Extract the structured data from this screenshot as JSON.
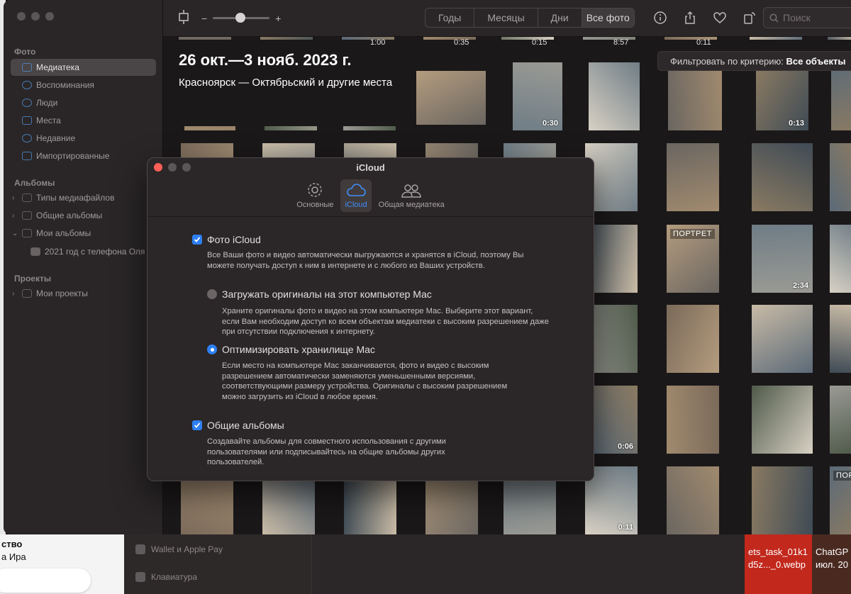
{
  "sidebar": {
    "sections": [
      {
        "header": "Фото",
        "items": [
          {
            "label": "Медиатека",
            "icon": "library-icon",
            "active": true
          },
          {
            "label": "Воспоминания",
            "icon": "memories-icon"
          },
          {
            "label": "Люди",
            "icon": "people-icon"
          },
          {
            "label": "Места",
            "icon": "places-icon"
          },
          {
            "label": "Недавние",
            "icon": "recent-icon"
          },
          {
            "label": "Импортированные",
            "icon": "import-icon"
          }
        ]
      },
      {
        "header": "Альбомы",
        "items": [
          {
            "label": "Типы медиафайлов",
            "icon": "folder-icon"
          },
          {
            "label": "Общие альбомы",
            "icon": "shared-albums-icon"
          },
          {
            "label": "Мои альбомы",
            "icon": "folder-icon"
          },
          {
            "label": "2021 год с телефона Оля",
            "icon": "album-thumb-icon"
          }
        ]
      },
      {
        "header": "Проекты",
        "items": [
          {
            "label": "Мои проекты",
            "icon": "folder-icon"
          }
        ]
      }
    ]
  },
  "toolbar": {
    "zoom_minus": "−",
    "zoom_plus": "+",
    "zoom_level": 0.4,
    "segments": [
      "Годы",
      "Месяцы",
      "Дни",
      "Все фото"
    ],
    "selected_segment": "Все фото",
    "search_placeholder": "Поиск"
  },
  "grid": {
    "title": "26 окт.—3 нояб. 2023 г.",
    "subtitle": "Красноярск — Октябрьский и другие места",
    "filter_label": "Фильтровать по критерию:",
    "filter_value": "Все объекты",
    "top_durations": [
      "1:00",
      "0:35",
      "0:15",
      "8:57",
      "0:11"
    ],
    "durations": [
      "0:30",
      "0:13",
      "2:34",
      "0:06",
      "0:11"
    ],
    "badges": [
      "ПОРТРЕТ",
      "ПОРТРЕТ"
    ]
  },
  "dialog": {
    "title": "iCloud",
    "tabs": [
      {
        "label": "Основные",
        "icon": "gear-icon"
      },
      {
        "label": "iCloud",
        "icon": "cloud-icon",
        "active": true
      },
      {
        "label": "Общая медиатека",
        "icon": "people-icon"
      }
    ],
    "icloud_photos": {
      "label": "Фото iCloud",
      "checked": true,
      "description": "Все Ваши фото и видео автоматически выгружаются и хранятся в iCloud, поэтому Вы можете получать доступ к ним в интернете и с любого из Ваших устройств."
    },
    "download_originals": {
      "label": "Загружать оригиналы на этот компьютер Mac",
      "selected": false,
      "description": "Храните оригиналы фото и видео на этом компьютере Mac. Выберите этот вариант, если Вам необходим доступ ко всем объектам медиатеки с высоким разрешением даже при отсутствии подключения к интернету."
    },
    "optimize_storage": {
      "label": "Оптимизировать хранилище Mac",
      "selected": true,
      "description": "Если место на компьютере Mac заканчивается, фото и видео с высоким разрешением автоматически заменяются уменьшенными версиями, соответствующими размеру устройства. Оригиналы с высоким разрешением можно загрузить из iCloud в любое время."
    },
    "shared_albums": {
      "label": "Общие альбомы",
      "checked": true,
      "description": "Создавайте альбомы для совместного использования с другими пользователями или подписывайтесь на общие альбомы других пользователей."
    }
  },
  "background": {
    "left_text_1": "ство",
    "left_text_2": "а Ира",
    "settings_items": [
      "Wallet и Apple Pay",
      "Клавиатура"
    ],
    "file_1_line1": "ets_task_01k1",
    "file_1_line2": "d5z..._0.webp",
    "file_2_line1": "ChatGP",
    "file_2_line2": "июл. 20"
  }
}
